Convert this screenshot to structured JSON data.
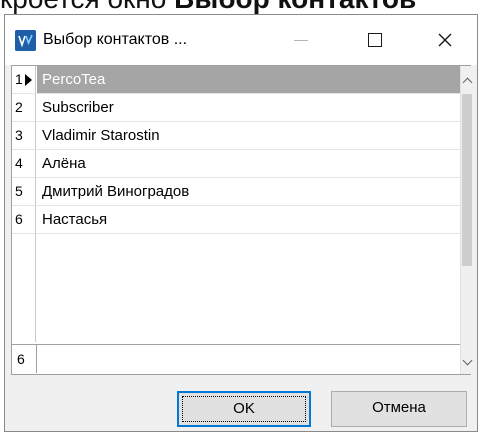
{
  "background_text": {
    "normal": "кроется окно ",
    "bold": "Выбор контактов"
  },
  "window": {
    "title": "Выбор контактов ...",
    "minimize_icon": "minimize-icon",
    "maximize_icon": "maximize-icon",
    "close_icon": "close-icon",
    "close_glyph": "✕"
  },
  "contacts": {
    "rows": [
      {
        "num": "1",
        "name": "PercoTea",
        "selected": true
      },
      {
        "num": "2",
        "name": "Subscriber"
      },
      {
        "num": "3",
        "name": "Vladimir Starostin"
      },
      {
        "num": "4",
        "name": "Алёна"
      },
      {
        "num": "5",
        "name": "Дмитрий Виноградов"
      },
      {
        "num": "6",
        "name": "Настасья"
      }
    ],
    "record_count": "6"
  },
  "buttons": {
    "ok": "OK",
    "cancel": "Отмена"
  },
  "colors": {
    "selection": "#a5a5a5",
    "accent": "#0078d7",
    "icon": "#1e5fa8"
  }
}
